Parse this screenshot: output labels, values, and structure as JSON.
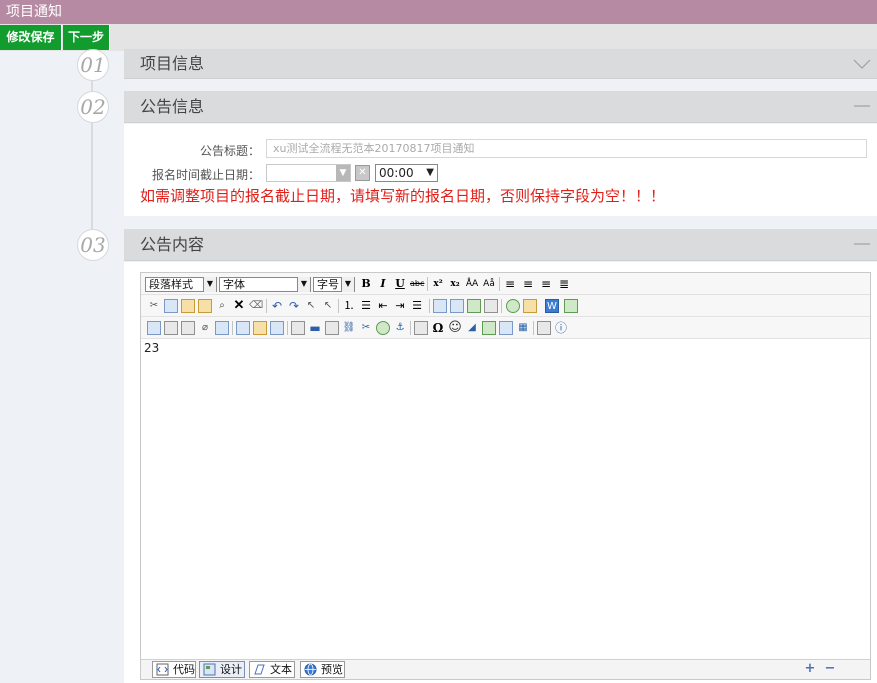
{
  "app": {
    "title": "项目通知"
  },
  "toolbar": {
    "save_label": "修改保存",
    "next_label": "下一步"
  },
  "steps": [
    {
      "number": "01",
      "title": "项目信息",
      "state": "collapsed"
    },
    {
      "number": "02",
      "title": "公告信息",
      "state": "expanded"
    },
    {
      "number": "03",
      "title": "公告内容",
      "state": "expanded"
    }
  ],
  "form": {
    "title_label": "公告标题：",
    "title_value": "xu测试全流程无范本20170817项目通知",
    "deadline_label": "报名时间截止日期：",
    "deadline_value": "",
    "time_value": "00:00",
    "warning": "如需调整项目的报名截止日期，请填写新的报名日期，否则保持字段为空！！！"
  },
  "editor": {
    "paragraph_style": "段落样式",
    "font_family": "字体",
    "font_size": "字号",
    "content": "23",
    "footer_tabs": [
      "代码",
      "设计",
      "文本",
      "预览"
    ],
    "active_tab": "设计"
  },
  "colors": {
    "titlebar": "#b78aa3",
    "button": "#139c2e",
    "warning": "#e1201a",
    "panel_header": "#dadbdd"
  }
}
